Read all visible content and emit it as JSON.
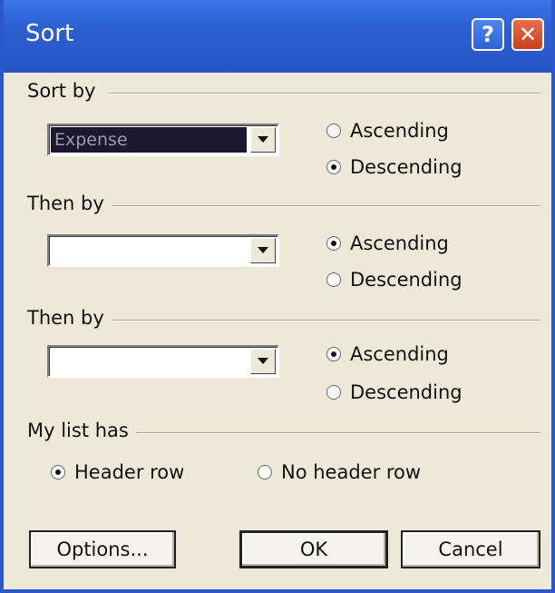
{
  "window": {
    "title": "Sort",
    "help_glyph": "?",
    "close_glyph": "✕"
  },
  "sort_by": {
    "label": "Sort by",
    "value": "Expense",
    "ascending_label": "Ascending",
    "descending_label": "Descending",
    "selected": "descending"
  },
  "then_by_1": {
    "label": "Then by",
    "value": "",
    "ascending_label": "Ascending",
    "descending_label": "Descending",
    "selected": "ascending"
  },
  "then_by_2": {
    "label": "Then by",
    "value": "",
    "ascending_label": "Ascending",
    "descending_label": "Descending",
    "selected": "ascending"
  },
  "my_list_has": {
    "label": "My list has",
    "header_row_label": "Header row",
    "no_header_row_label": "No header row",
    "selected": "header_row"
  },
  "buttons": {
    "options_label": "Options...",
    "ok_label": "OK",
    "cancel_label": "Cancel"
  }
}
